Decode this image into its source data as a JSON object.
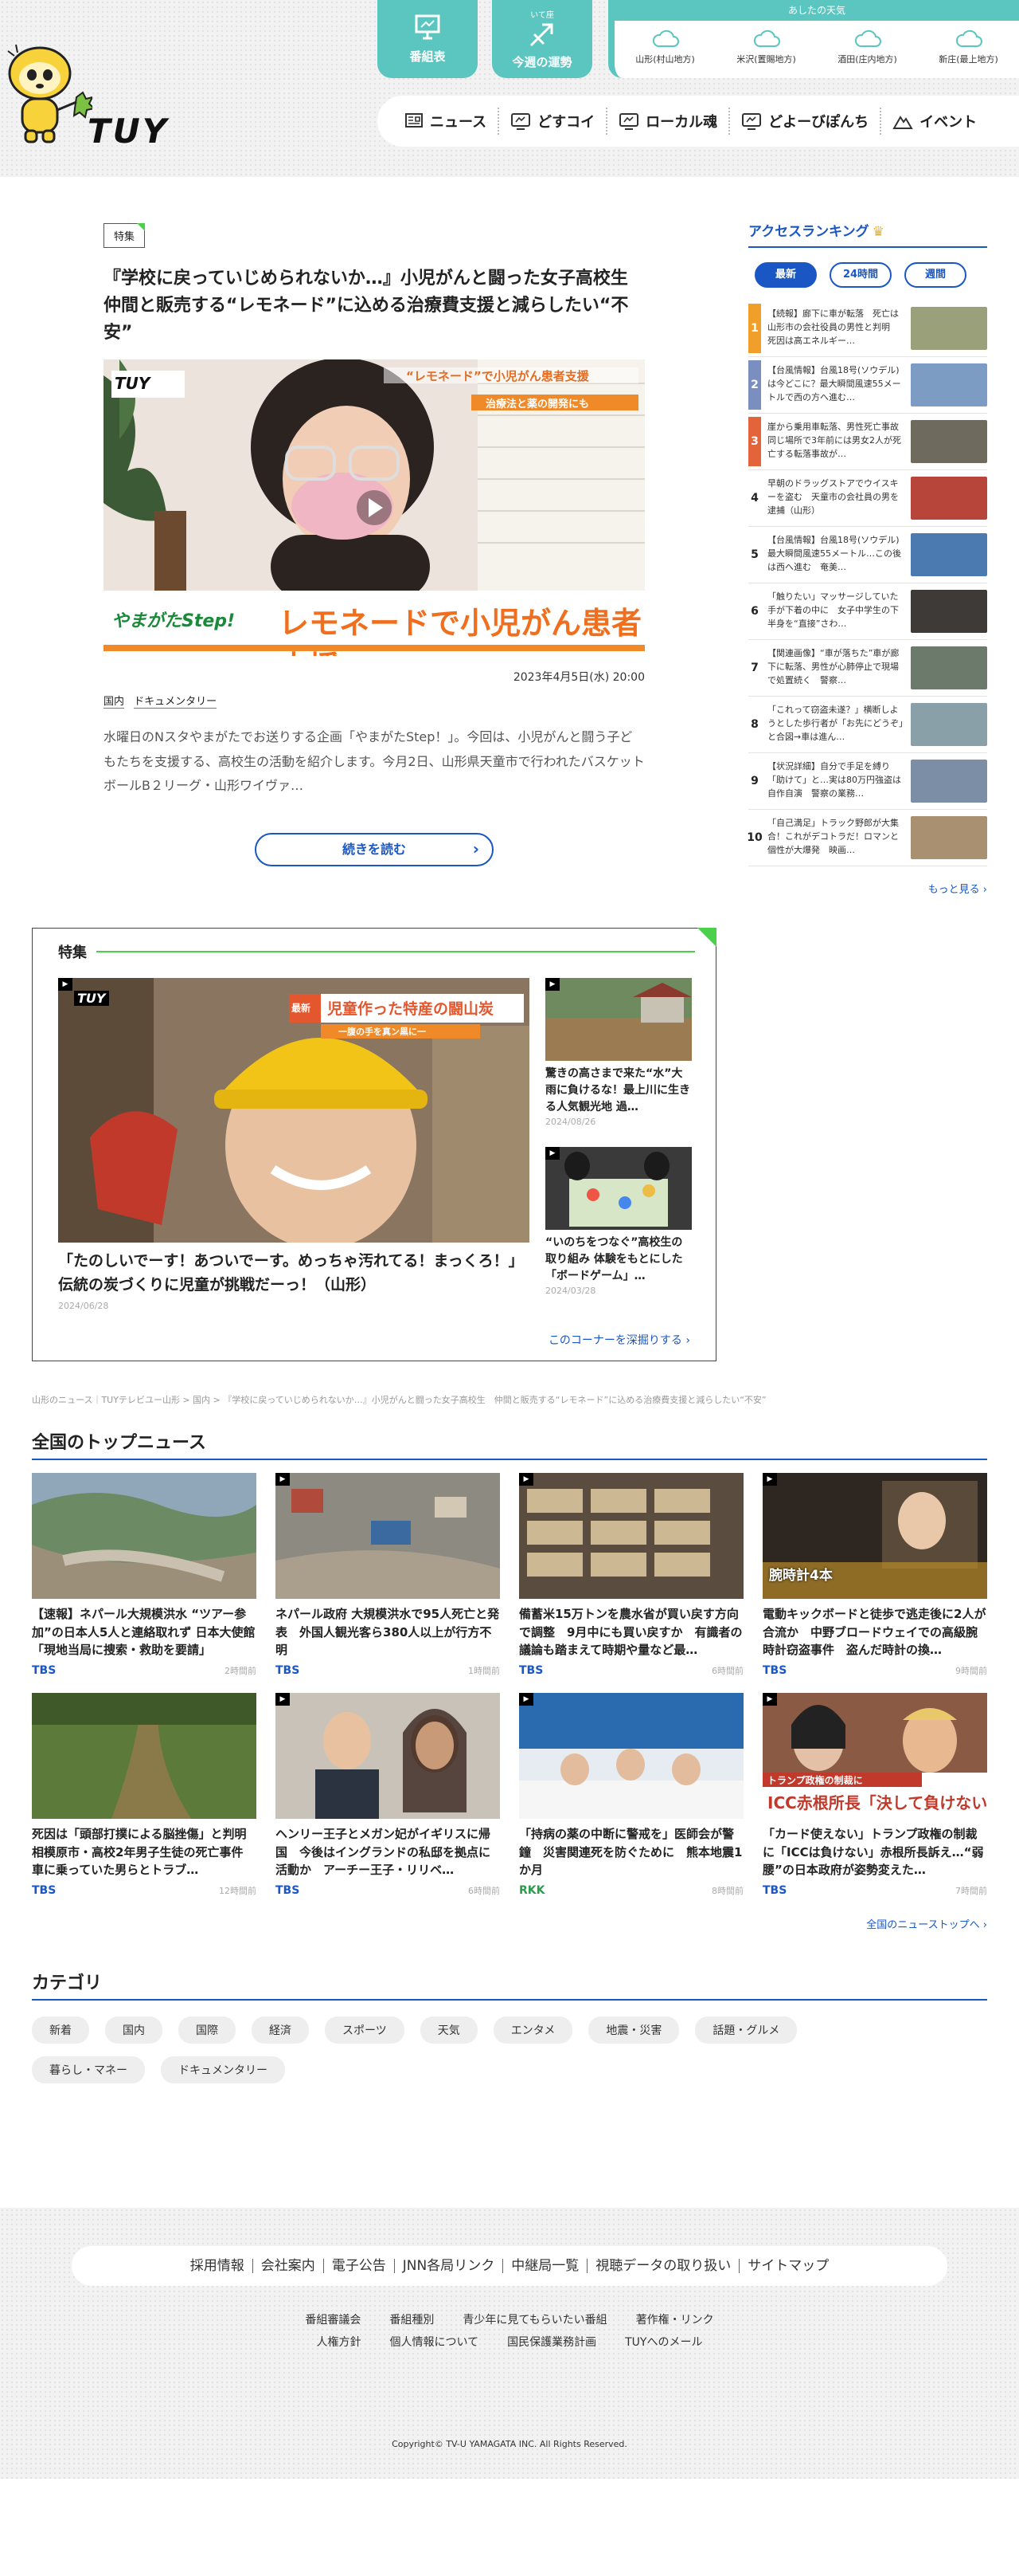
{
  "header": {
    "logo_text": "TUY",
    "program_button": "番組表",
    "fortune_small": "いて座",
    "fortune_button": "今週の運勢",
    "weather_title": "あしたの天気",
    "weather_cities": [
      "山形(村山地方)",
      "米沢(置賜地方)",
      "酒田(庄内地方)",
      "新庄(最上地方)"
    ]
  },
  "nav": [
    "ニュース",
    "どすコイ",
    "ローカル魂",
    "どよーびぽんち",
    "イベント"
  ],
  "feature": {
    "badge": "特集",
    "title": "『学校に戻っていじめられないか…』小児がんと闘った女子高校生　仲間と販売する“レモネード”に込める治療費支援と減らしたい“不安”",
    "image_caption": "レモネードで小児がん患者支援",
    "image_logo": "やまがたStep!",
    "image_banner_sub": "“レモネード”で小児がん患者支援",
    "image_banner_sub2": "治療法と薬の開発にも",
    "date": "2023年4月5日(水) 20:00",
    "tags": [
      "国内",
      "ドキュメンタリー"
    ],
    "summary": "水曜日のNスタやまがたでお送りする企画「やまがたStep！」。今回は、小児がんと闘う子どもたちを支援する、高校生の活動を紹介します。今月2日、山形県天童市で行われたバスケットボールB２リーグ・山形ワイヴァ…",
    "read_more": "続きを読む"
  },
  "ranking": {
    "title": "アクセスランキング",
    "tabs": [
      "最新",
      "24時間",
      "週間"
    ],
    "items": [
      {
        "num": "1",
        "text": "【続報】廊下に車が転落　死亡は山形市の会社役員の男性と判明　死因は高エネルギー…",
        "color": "#f0a02a"
      },
      {
        "num": "2",
        "text": "【台風情報】台風18号(ソウデル)は今どこに？最大瞬間風速55メートルで西の方へ進む…",
        "color": "#7a8fc0"
      },
      {
        "num": "3",
        "text": "崖から乗用車転落、男性死亡事故　同じ場所で3年前には男女2人が死亡する転落事故が…",
        "color": "#e3643a"
      },
      {
        "num": "4",
        "text": "早朝のドラッグストアでウイスキーを盗む　天童市の会社員の男を逮捕（山形）",
        "color": "#ffffff"
      },
      {
        "num": "5",
        "text": "【台風情報】台風18号(ソウデル)　最大瞬間風速55メートル…この後は西へ進む　奄美…",
        "color": "#ffffff"
      },
      {
        "num": "6",
        "text": "「触りたい」マッサージしていた手が下着の中に　女子中学生の下半身を“直接”さわ…",
        "color": "#ffffff"
      },
      {
        "num": "7",
        "text": "【関連画像】“車が落ちた”車が廊下に転落、男性が心肺停止で現場で処置続く　警察…",
        "color": "#ffffff"
      },
      {
        "num": "8",
        "text": "「これって窃盗未遂？」横断しようとした歩行者が「お先にどうぞ」と合図→車は進ん…",
        "color": "#ffffff"
      },
      {
        "num": "9",
        "text": "【状況詳細】自分で手足を縛り「助けて」と…実は80万円強盗は自作自演　警察の業務…",
        "color": "#ffffff"
      },
      {
        "num": "10",
        "text": "「自己満足」トラック野郎が大集合！これがデコトラだ！ロマンと個性が大爆発　映画…",
        "color": "#ffffff"
      }
    ],
    "more": "もっと見る"
  },
  "special": {
    "title": "特集",
    "main_title": "「たのしいでーす！あついでーす。めっちゃ汚れてる！まっくろ！」伝統の炭づくりに児童が挑戦だーっ！（山形）",
    "main_date": "2024/06/28",
    "main_banner": "児童作った特産の闘山炭",
    "main_banner_tag": "最新",
    "main_banner_sub": "一腹の手を真ン黒に一",
    "side": [
      {
        "title": "驚きの高さまで来た“水”大雨に負けるな！最上川に生きる人気観光地 過…",
        "date": "2024/08/26"
      },
      {
        "title": "“いのちをつなぐ”高校生の取り組み 体験をもとにした「ボードゲーム」…",
        "date": "2024/03/28"
      }
    ],
    "more": "このコーナーを深掘りする"
  },
  "breadcrumb": "山形のニュース｜TUYテレビユー山形 > 国内 > 『学校に戻っていじめられないか…』小児がんと闘った女子高校生　仲間と販売する“レモネード”に込める治療費支援と減らしたい“不安”",
  "national": {
    "title": "全国のトップニュース",
    "items": [
      {
        "title": "【速報】ネパール大規模洪水 “ツアー参加”の日本人5人と連絡取れず 日本大使館「現地当局に捜索・救助を要請」",
        "src": "TBS",
        "time": "2時間前"
      },
      {
        "title": "ネパール政府 大規模洪水で95人死亡と発表　外国人観光客ら380人以上が行方不明",
        "src": "TBS",
        "time": "1時間前"
      },
      {
        "title": "備蓄米15万トンを農水省が買い戻す方向で調整　9月中にも買い戻すか　有識者の議論も踏まえて時期や量など最…",
        "src": "TBS",
        "time": "6時間前"
      },
      {
        "title": "電動キックボードと徒歩で逃走後に2人が合流か　中野ブロードウェイでの高級腕時計窃盗事件　盗んだ時計の換…",
        "src": "TBS",
        "time": "9時間前"
      },
      {
        "title": "死因は「頭部打撲による脳挫傷」と判明　相模原市・高校2年男子生徒の死亡事件　車に乗っていた男らとトラブ…",
        "src": "TBS",
        "time": "12時間前"
      },
      {
        "title": "ヘンリー王子とメガン妃がイギリスに帰国　今後はイングランドの私邸を拠点に活動か　アーチー王子・リリベ…",
        "src": "TBS",
        "time": "6時間前"
      },
      {
        "title": "「持病の薬の中断に警戒を」医師会が警鐘　災害関連死を防ぐために　熊本地震1か月",
        "src": "RKK",
        "time": "8時間前"
      },
      {
        "title": "「カード使えない」トランプ政権の制裁に「ICCは負けない」赤根所長訴え…“弱腰”の日本政府が姿勢変えた…",
        "src": "TBS",
        "time": "7時間前"
      }
    ],
    "img4_caption": "腕時計4本",
    "img8_caption": "ICC赤根所長「決して負けない」",
    "img8_tag": "トランプ政権の制裁に",
    "more": "全国のニューストップへ"
  },
  "categories": {
    "title": "カテゴリ",
    "items": [
      "新着",
      "国内",
      "国際",
      "経済",
      "スポーツ",
      "天気",
      "エンタメ",
      "地震・災害",
      "話題・グルメ",
      "暮らし・マネー",
      "ドキュメンタリー"
    ]
  },
  "footer": {
    "links1": [
      "採用情報",
      "会社案内",
      "電子公告",
      "JNN各局リンク",
      "中継局一覧",
      "視聴データの取り扱い",
      "サイトマップ"
    ],
    "links2": [
      "番組審議会",
      "番組種別",
      "青少年に見てもらいたい番組",
      "著作権・リンク"
    ],
    "links3": [
      "人権方針",
      "個人情報について",
      "国民保護業務計画",
      "TUYへのメール"
    ],
    "copyright": "Copyright© TV-U YAMAGATA INC. All Rights Reserved."
  },
  "colors": {
    "brand_teal": "#5bc6bf",
    "accent_blue": "#1a57c5",
    "special_green": "#4ad04a"
  }
}
